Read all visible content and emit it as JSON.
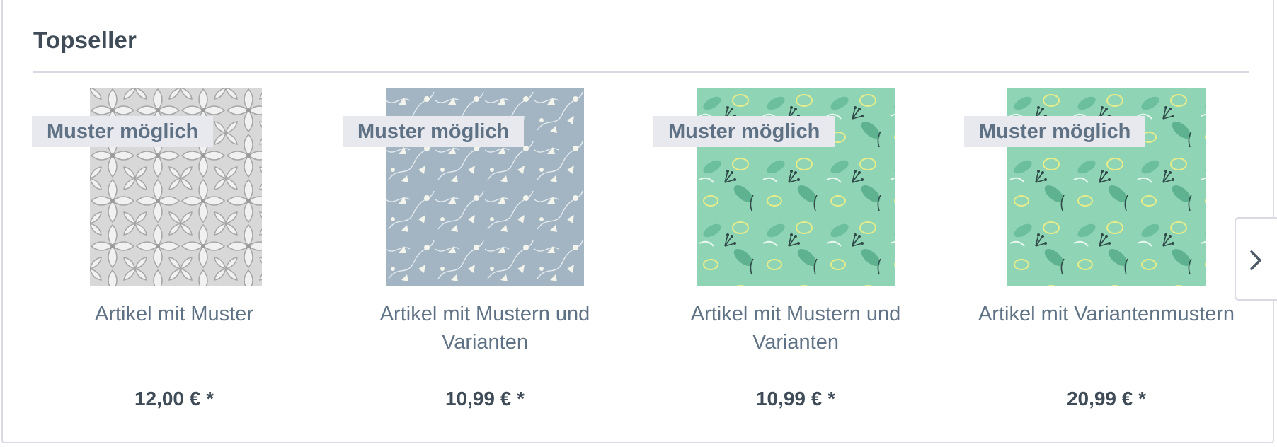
{
  "section": {
    "title": "Topseller"
  },
  "products": [
    {
      "badge": "Muster möglich",
      "name": "Artikel mit Muster",
      "price": "12,00 € *",
      "image": "grey-geometric-flower-pattern"
    },
    {
      "badge": "Muster möglich",
      "name": "Artikel mit Mustern und Varianten",
      "price": "10,99 € *",
      "image": "blue-floral-pattern"
    },
    {
      "badge": "Muster möglich",
      "name": "Artikel mit Mustern und Varianten",
      "price": "10,99 € *",
      "image": "mint-botanical-pattern"
    },
    {
      "badge": "Muster möglich",
      "name": "Artikel mit Variantenmustern",
      "price": "20,99 € *",
      "image": "mint-botanical-pattern"
    }
  ],
  "navigation": {
    "next_icon": "chevron-right-icon"
  },
  "colors": {
    "heading": "#3f4c58",
    "text": "#5f7285",
    "badge_bg": "#e8e9ee",
    "border": "#dadae5"
  }
}
